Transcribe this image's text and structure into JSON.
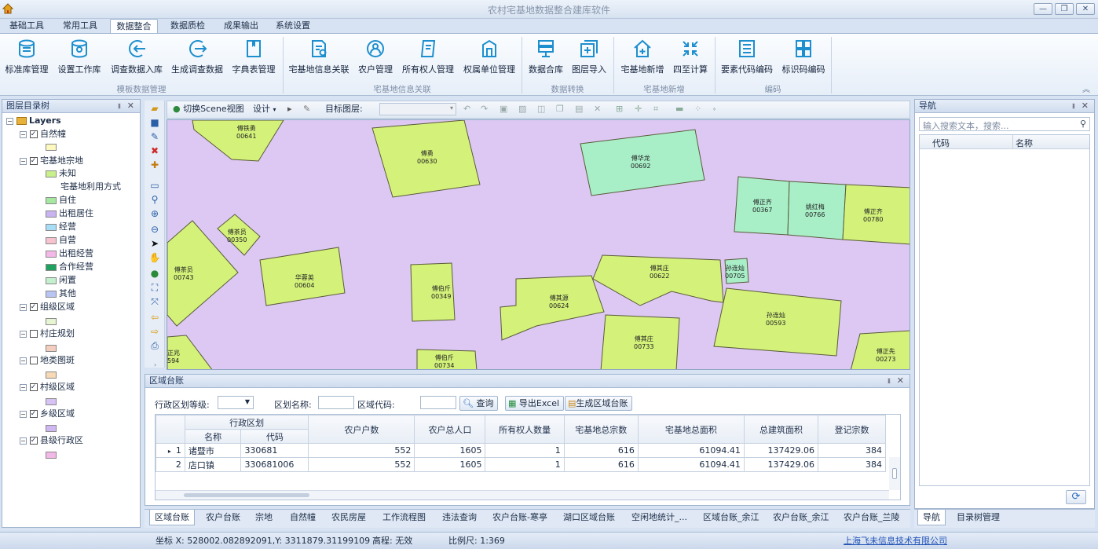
{
  "app": {
    "title": "农村宅基地数据整合建库软件"
  },
  "menu": {
    "tabs": [
      "基础工具",
      "常用工具",
      "数据整合",
      "数据质检",
      "成果输出",
      "系统设置"
    ],
    "active": "数据整合"
  },
  "ribbon": {
    "buttons": [
      "标准库管理",
      "设置工作库",
      "调查数据入库",
      "生成调查数据",
      "字典表管理",
      "宅基地信息关联",
      "农户管理",
      "所有权人管理",
      "权属单位管理",
      "数据合库",
      "图层导入",
      "宅基地新增",
      "四至计算",
      "要素代码编码",
      "标识码编码"
    ],
    "groups": [
      "模板数据管理",
      "宅基地信息关联",
      "数据转换",
      "宅基地新增",
      "编码"
    ]
  },
  "layer_tree": {
    "title": "图层目录树",
    "root": "Layers",
    "items": [
      {
        "label": "自然幢",
        "checked": true
      },
      {
        "label": "宅基地宗地",
        "checked": true
      },
      {
        "label": "未知"
      },
      {
        "label": "宅基地利用方式"
      },
      {
        "label": "自住"
      },
      {
        "label": "出租居住"
      },
      {
        "label": "经营"
      },
      {
        "label": "自营"
      },
      {
        "label": "出租经营"
      },
      {
        "label": "合作经营"
      },
      {
        "label": "闲置"
      },
      {
        "label": "其他"
      },
      {
        "label": "组级区域",
        "checked": true
      },
      {
        "label": "村庄规划",
        "checked": false
      },
      {
        "label": "地类图斑",
        "checked": false
      },
      {
        "label": "村级区域",
        "checked": true
      },
      {
        "label": "乡级区域",
        "checked": true
      },
      {
        "label": "县级行政区",
        "checked": true
      }
    ],
    "colors": {
      "natural": "#fdf8c0",
      "unknown": "#c9f08a",
      "self_live": "#a5e8a0",
      "rent_live": "#c9b3f0",
      "business": "#a8def5",
      "self_business": "#f7c3cf",
      "rent_business": "#f4b8e8",
      "coop_business": "#1fa15f",
      "idle": "#c3f0cd",
      "other": "#b8c4f2",
      "group": "#e6f5d2",
      "village_plan": "#f3cdbd",
      "landuse": "#f7d9b5",
      "village": "#d7c4f5",
      "township": "#cfb8f2",
      "county": "#f2b8e6"
    }
  },
  "map_toolbar": {
    "scene": "切换Scene视图",
    "design": "设计",
    "target_layer": "目标图层:"
  },
  "map": {
    "parcels": [
      {
        "name": "傅铁勇",
        "code": "00641"
      },
      {
        "name": "傅勇",
        "code": "00630"
      },
      {
        "name": "傅华龙",
        "code": "00692"
      },
      {
        "name": "傅正齐",
        "code": "00367"
      },
      {
        "name": "姚红梅",
        "code": "00766"
      },
      {
        "name": "傅正齐",
        "code": "00780"
      },
      {
        "name": "傅茶员",
        "code": "00350"
      },
      {
        "name": "傅茶员",
        "code": "00743"
      },
      {
        "name": "华蓉英",
        "code": "00604"
      },
      {
        "name": "傅伯斤",
        "code": "00349"
      },
      {
        "name": "傅其源",
        "code": "00624"
      },
      {
        "name": "傅其庄",
        "code": "00622"
      },
      {
        "name": "孙连灿",
        "code": "00705"
      },
      {
        "name": "孙连灿",
        "code": "00593"
      },
      {
        "name": "傅其庄",
        "code": "00733"
      },
      {
        "name": "傅伯斤",
        "code": "00734"
      },
      {
        "name": "傅正先",
        "code": "00273"
      },
      {
        "name": "正兆",
        "code": "594"
      }
    ]
  },
  "region_ledger": {
    "title": "区域台账",
    "filters": {
      "level_label": "行政区划等级:",
      "name_label": "区划名称:",
      "code_label": "区域代码:"
    },
    "buttons": {
      "query": "查询",
      "export": "导出Excel",
      "generate": "生成区域台账"
    },
    "group_header": "行政区划",
    "columns": [
      "名称",
      "代码",
      "农户户数",
      "农户总人口",
      "所有权人数量",
      "宅基地总宗数",
      "宅基地总面积",
      "总建筑面积",
      "登记宗数"
    ],
    "rows": [
      {
        "idx": "1",
        "name": "诸暨市",
        "code": "330681",
        "households": "552",
        "population": "1605",
        "owners": "1",
        "parcels": "616",
        "area": "61094.41",
        "build_area": "137429.06",
        "registered": "384"
      },
      {
        "idx": "2",
        "name": "店口镇",
        "code": "330681006",
        "households": "552",
        "population": "1605",
        "owners": "1",
        "parcels": "616",
        "area": "61094.41",
        "build_area": "137429.06",
        "registered": "384"
      }
    ]
  },
  "bottom_tabs": [
    "区域台账",
    "农户台账",
    "宗地",
    "自然幢",
    "农民房屋",
    "工作流程图",
    "违法查询",
    "农户台账-寒亭",
    "湖口区域台账",
    "空闲地统计_...",
    "区域台账_余江",
    "农户台账_余江",
    "农户台账_兰陵"
  ],
  "navigator": {
    "title": "导航",
    "search_placeholder": "输入搜索文本，搜索...",
    "columns": [
      "代码",
      "名称"
    ],
    "tabs": [
      "导航",
      "目录树管理"
    ]
  },
  "status": {
    "coord": "坐标 X: 528002.082892091,Y: 3311879.31199109",
    "elevation": "高程: 无效",
    "scale": "比例尺: 1:369",
    "company": "上海飞未信息技术有限公司"
  }
}
